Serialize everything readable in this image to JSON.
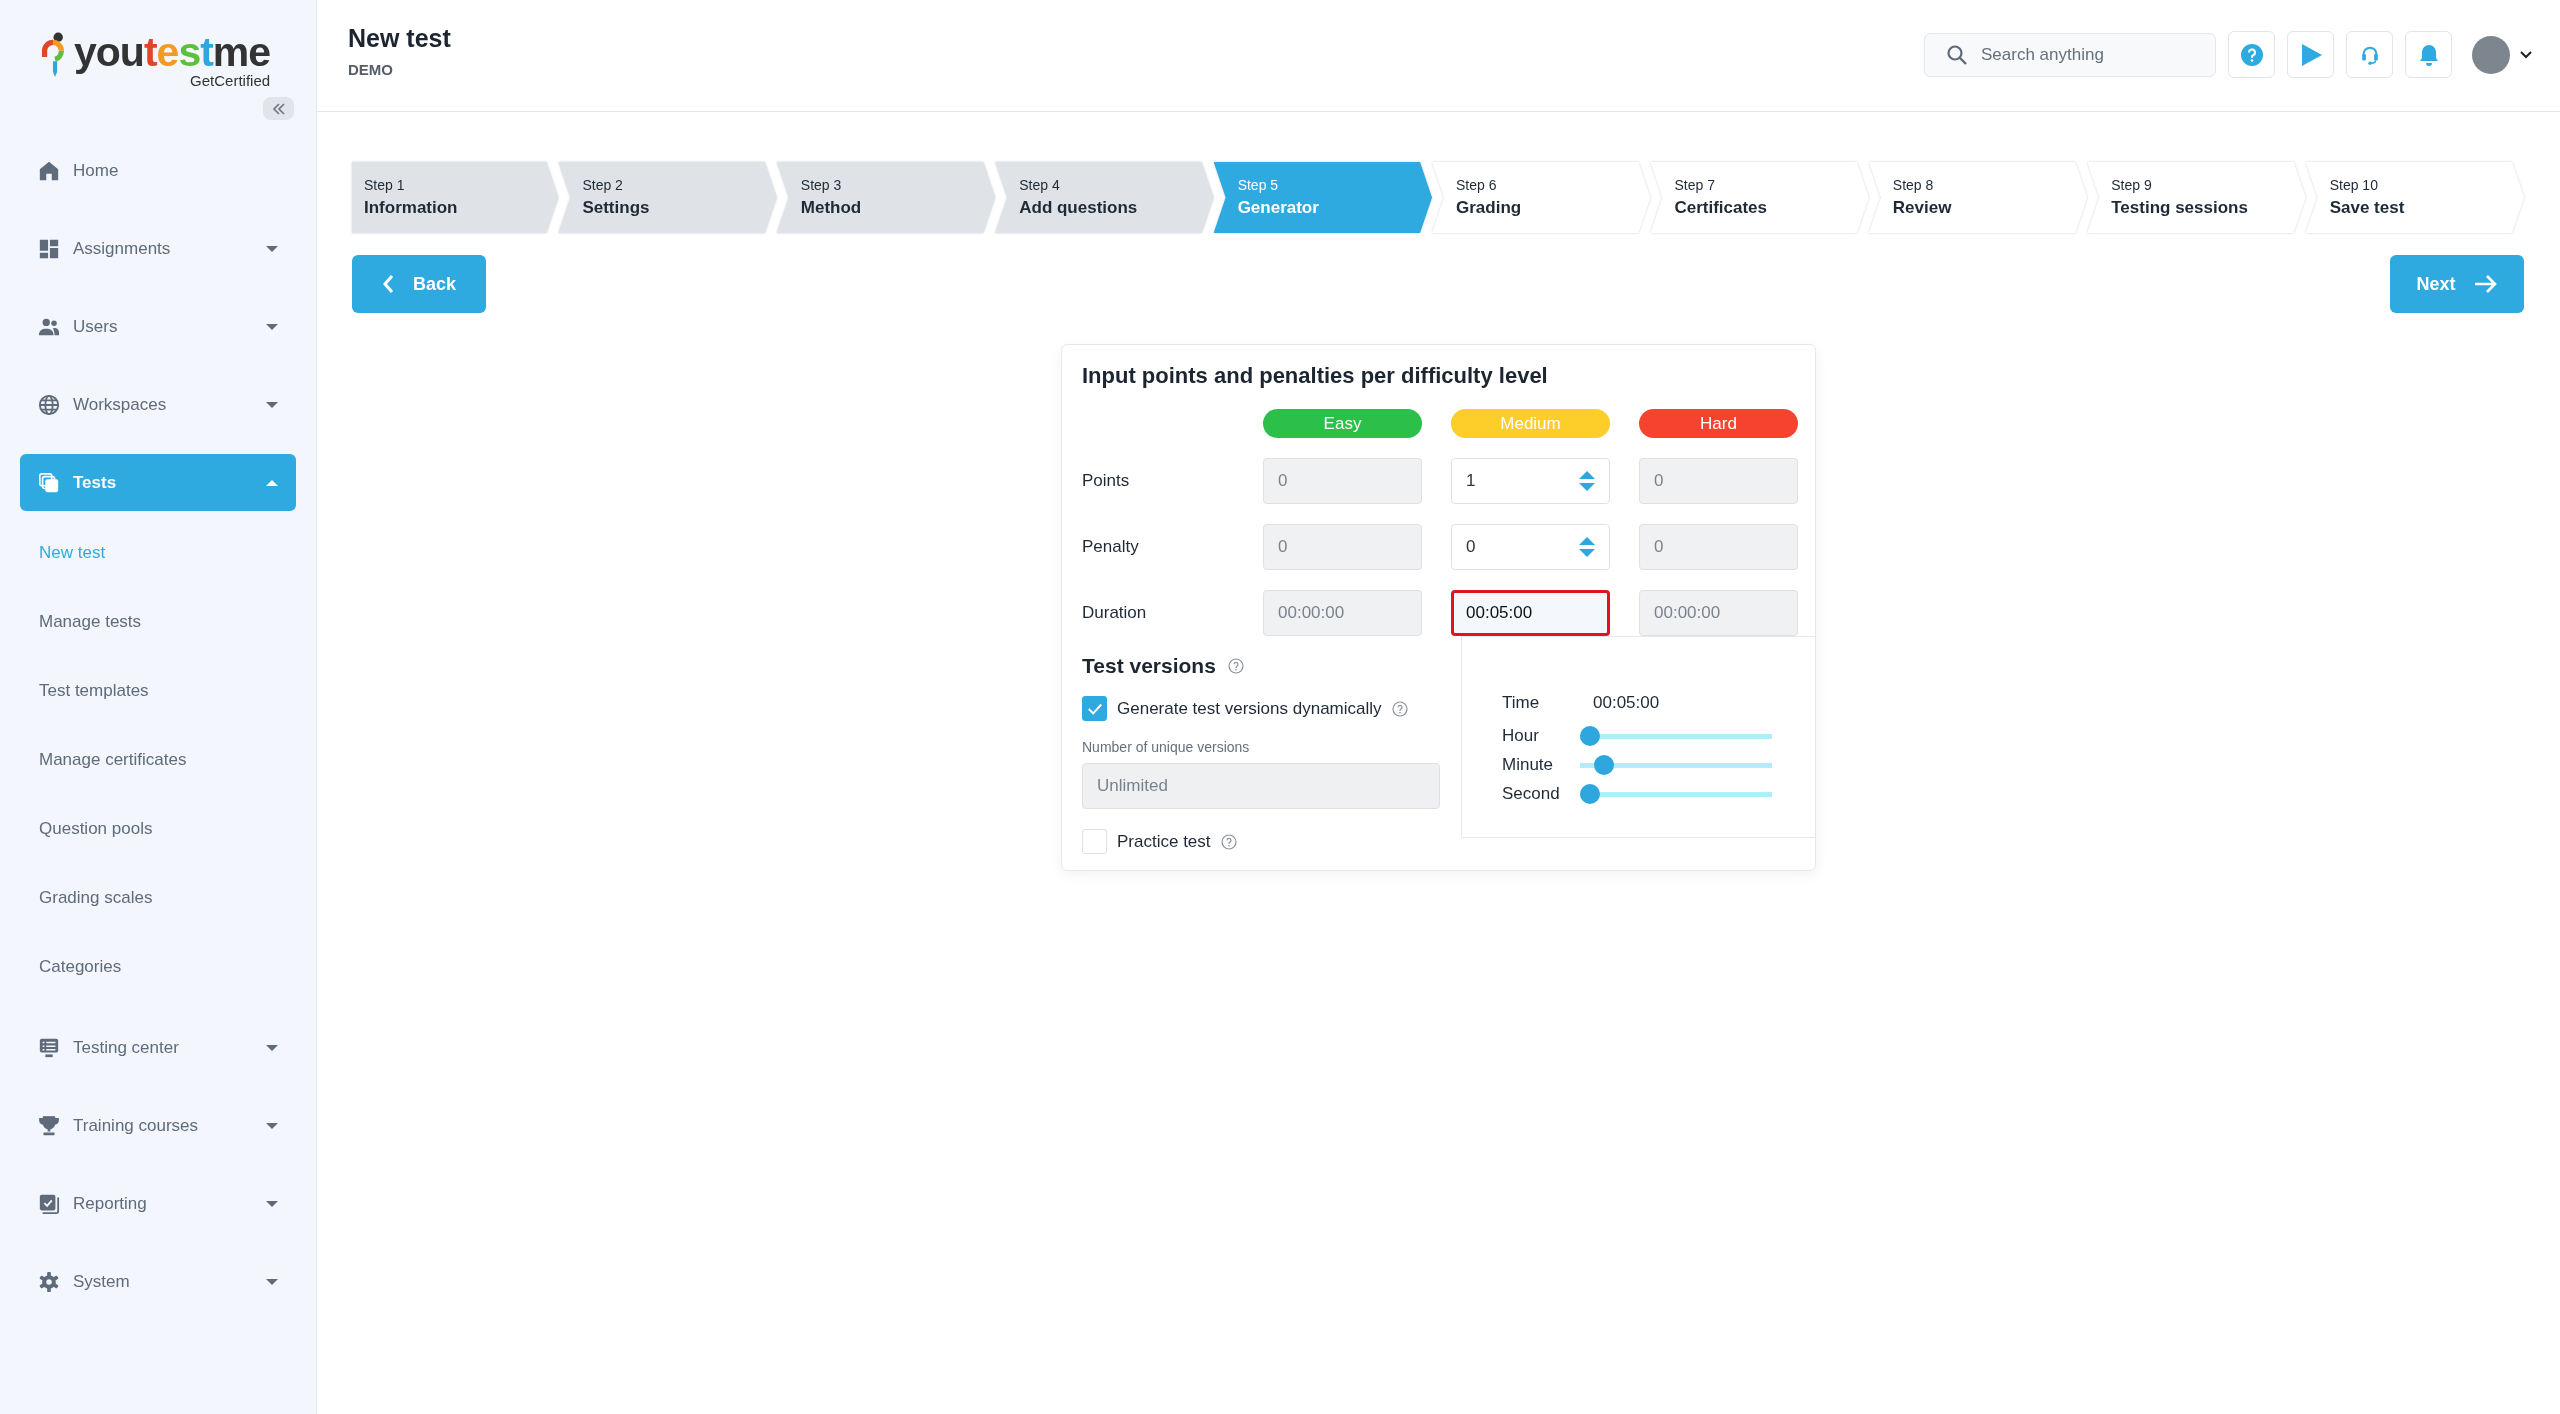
{
  "sidebar": {
    "logo": {
      "wordmark": "youtestme",
      "tagline": "GetCertified"
    },
    "items": [
      {
        "label": "Home",
        "kind": "link",
        "selected": false
      },
      {
        "label": "Assignments",
        "kind": "group",
        "expanded": false,
        "selected": false
      },
      {
        "label": "Users",
        "kind": "group",
        "expanded": false,
        "selected": false
      },
      {
        "label": "Workspaces",
        "kind": "group",
        "expanded": false,
        "selected": false
      },
      {
        "label": "Tests",
        "kind": "group",
        "expanded": true,
        "selected": true,
        "children": [
          {
            "label": "New test",
            "selected": true
          },
          {
            "label": "Manage tests",
            "selected": false
          },
          {
            "label": "Test templates",
            "selected": false
          },
          {
            "label": "Manage certificates",
            "selected": false
          },
          {
            "label": "Question pools",
            "selected": false
          },
          {
            "label": "Grading scales",
            "selected": false
          },
          {
            "label": "Categories",
            "selected": false
          }
        ]
      },
      {
        "label": "Testing center",
        "kind": "group",
        "expanded": false,
        "selected": false
      },
      {
        "label": "Training courses",
        "kind": "group",
        "expanded": false,
        "selected": false
      },
      {
        "label": "Reporting",
        "kind": "group",
        "expanded": false,
        "selected": false
      },
      {
        "label": "System",
        "kind": "group",
        "expanded": false,
        "selected": false
      }
    ]
  },
  "header": {
    "title": "New test",
    "subtitle": "DEMO",
    "search": {
      "placeholder": "Search anything"
    }
  },
  "wizard": {
    "steps": [
      {
        "step": "Step 1",
        "label": "Information",
        "selected": false,
        "completed": true
      },
      {
        "step": "Step 2",
        "label": "Settings",
        "selected": false,
        "completed": true
      },
      {
        "step": "Step 3",
        "label": "Method",
        "selected": false,
        "completed": true
      },
      {
        "step": "Step 4",
        "label": "Add questions",
        "selected": false,
        "completed": true
      },
      {
        "step": "Step 5",
        "label": "Generator",
        "selected": true,
        "completed": false
      },
      {
        "step": "Step 6",
        "label": "Grading",
        "selected": false,
        "completed": false
      },
      {
        "step": "Step 7",
        "label": "Certificates",
        "selected": false,
        "completed": false
      },
      {
        "step": "Step 8",
        "label": "Review",
        "selected": false,
        "completed": false
      },
      {
        "step": "Step 9",
        "label": "Testing sessions",
        "selected": false,
        "completed": false
      },
      {
        "step": "Step 10",
        "label": "Save test",
        "selected": false,
        "completed": false
      }
    ],
    "back_button": "Back",
    "next_button": "Next"
  },
  "difficulty_card": {
    "title": "Input points and penalties per difficulty level",
    "levels": [
      {
        "label": "Easy",
        "color": "#2cc04a"
      },
      {
        "label": "Medium",
        "color": "#fdcd2a"
      },
      {
        "label": "Hard",
        "color": "#f5432f"
      }
    ],
    "rows": [
      {
        "label": "Points",
        "kind": "number",
        "cells": [
          {
            "value": "0",
            "disabled": true
          },
          {
            "value": "1",
            "disabled": false
          },
          {
            "value": "0",
            "disabled": true
          }
        ]
      },
      {
        "label": "Penalty",
        "kind": "number",
        "cells": [
          {
            "value": "0",
            "disabled": true
          },
          {
            "value": "0",
            "disabled": false
          },
          {
            "value": "0",
            "disabled": true
          }
        ]
      },
      {
        "label": "Duration",
        "kind": "time",
        "cells": [
          {
            "value": "00:00:00",
            "disabled": true,
            "focused": false
          },
          {
            "value": "00:05:00",
            "disabled": false,
            "focused": true
          },
          {
            "value": "00:00:00",
            "disabled": true,
            "focused": false
          }
        ]
      }
    ],
    "test_versions": {
      "title": "Test versions",
      "generate_dynamically": {
        "label": "Generate test versions dynamically",
        "checked": true
      },
      "unique_versions": {
        "label": "Number of unique versions",
        "value": "Unlimited",
        "disabled": true
      },
      "practice_test": {
        "label": "Practice test",
        "checked": false
      }
    },
    "time_picker": {
      "label": "Time",
      "value": "00:05:00",
      "sliders": [
        {
          "label": "Hour",
          "level": 0
        },
        {
          "label": "Minute",
          "level": 0.08
        },
        {
          "label": "Second",
          "level": 0
        }
      ]
    }
  }
}
